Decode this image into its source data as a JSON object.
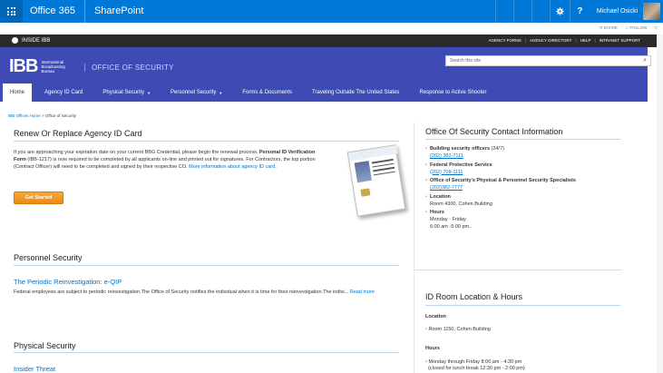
{
  "suite": {
    "app1": "Office 365",
    "app2": "SharePoint",
    "help_label": "?",
    "user_name": "Michael Osicki"
  },
  "actions": {
    "share": "SHARE",
    "follow": "FOLLOW"
  },
  "inside": {
    "label": "INSIDE IBB",
    "links": [
      "AGENCY FORMS",
      "AGENCY DIRECTORY",
      "HELP",
      "INTRANET SUPPORT"
    ]
  },
  "banner": {
    "logo_text": "IBB",
    "logo_sub": "International Broadcasting Bureau",
    "office_title": "OFFICE OF SECURITY",
    "search_placeholder": "Search this site"
  },
  "nav": {
    "items": [
      {
        "label": "Home",
        "dropdown": false
      },
      {
        "label": "Agency ID Card",
        "dropdown": false
      },
      {
        "label": "Physical Security",
        "dropdown": true
      },
      {
        "label": "Personnel Security",
        "dropdown": true
      },
      {
        "label": "Forms & Documents",
        "dropdown": false
      },
      {
        "label": "Traveling Outside The United States",
        "dropdown": false
      },
      {
        "label": "Response to Active Shooter",
        "dropdown": false
      }
    ]
  },
  "breadcrumb": {
    "home": "IBB Offices Home",
    "sep": " > ",
    "current": "Office of Security"
  },
  "renew": {
    "title": "Renew Or Replace Agency ID Card",
    "text1": "If you are approaching your expiration date on your current BBG Credential, please begin the renewal process. ",
    "text_bold": "Personal ID Verification Form",
    "text2": " (IBB-1217) is now required to be completed by all applicants on-line and printed out for signatures. For Contractors, the top portion (Contract Officer) will need to be completed and signed by their respective CO. ",
    "link": "More information about agency ID card",
    "text3": ".",
    "button": "Get Started"
  },
  "personnel": {
    "title": "Personnel Security",
    "article_title": "The Periodic Reinvestigation: e-QIP",
    "article_text": "Federal employees are subject to periodic reinvestigation.The Office of Security notifies the individual when it is time for their reinvestigation.The indivi... ",
    "read_more": "Read more"
  },
  "physical": {
    "title": "Physical Security",
    "article_title": "Insider Threat"
  },
  "contact": {
    "title": "Office Of Security Contact Information",
    "items": [
      {
        "label": "Building security officers",
        "suffix": " (24/7)",
        "phone": "(202) 382-7111"
      },
      {
        "label": "Federal Protective Service",
        "suffix": "",
        "phone": "(202) 708-1111"
      },
      {
        "label": "Office of Security's Physical & Personnel Security Specialists",
        "suffix": "",
        "phone": "(202)382-7777"
      }
    ],
    "location_label": "Location",
    "location": "Room 4300, Cohen Building",
    "hours_label": "Hours",
    "hours_days": "Monday - Friday",
    "hours_time": "6:00 am -5:00 pm.."
  },
  "idroom": {
    "title": "ID Room Location & Hours",
    "location_label": "Location",
    "location": "Room 1150, Cohen Building",
    "hours_label": "Hours",
    "hours_1": "Monday through Friday 8:00 am - 4:30 pm",
    "hours_2": "(closed for lunch break 12:30 pm - 2:00 pm)"
  }
}
